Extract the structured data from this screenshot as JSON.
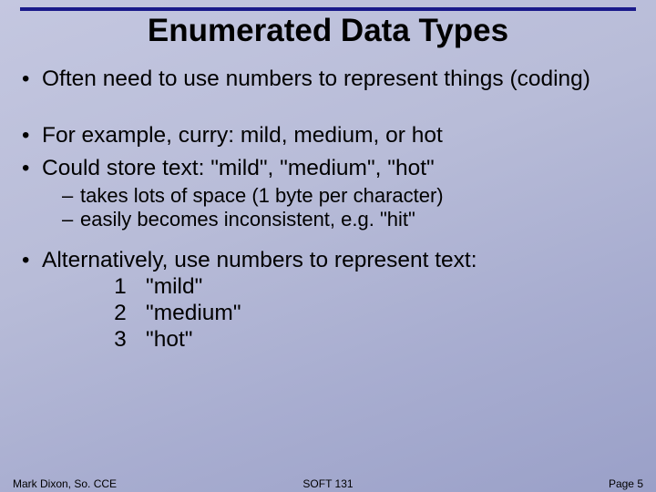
{
  "title": "Enumerated Data Types",
  "bullets": {
    "b1": "Often need to use numbers to represent things (coding)",
    "b2": "For example, curry: mild, medium, or hot",
    "b3": "Could store text: \"mild\", \"medium\", \"hot\"",
    "b3_sub1": "takes lots of space (1 byte per character)",
    "b3_sub2": "easily becomes inconsistent, e.g. \"hit\"",
    "b4": "Alternatively, use numbers to represent text:"
  },
  "mapping": [
    {
      "num": "1",
      "text": "\"mild\""
    },
    {
      "num": "2",
      "text": "\"medium\""
    },
    {
      "num": "3",
      "text": "\"hot\""
    }
  ],
  "footer": {
    "left": "Mark Dixon, So. CCE",
    "center": "SOFT 131",
    "right": "Page 5"
  }
}
